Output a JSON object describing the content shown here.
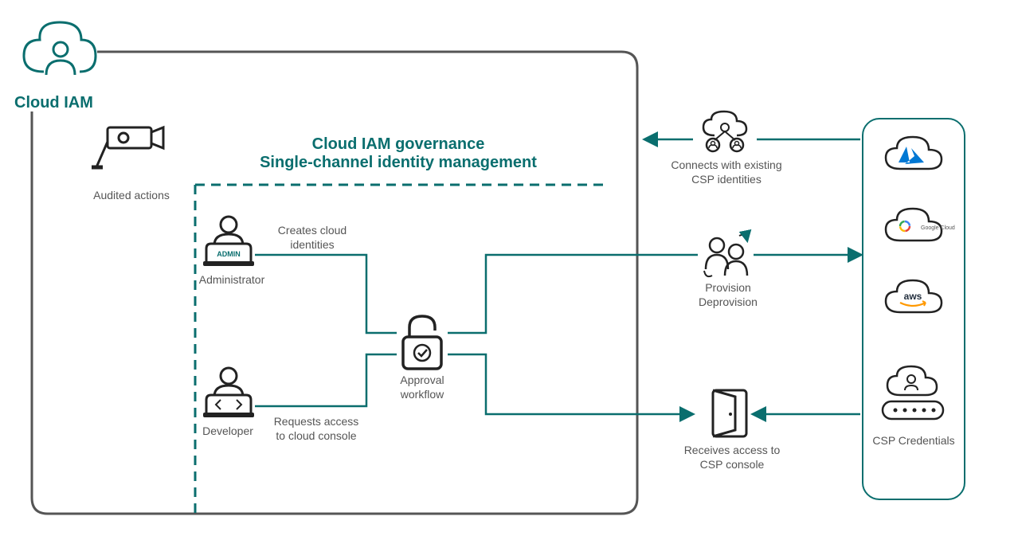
{
  "title": "Cloud IAM",
  "governance": {
    "line1": "Cloud IAM governance",
    "line2": "Single-channel identity management"
  },
  "nodes": {
    "audited": "Audited actions",
    "admin": {
      "label": "Administrator",
      "badge": "ADMIN",
      "arrow": "Creates cloud\nidentities"
    },
    "developer": {
      "label": "Developer",
      "arrow": "Requests access\nto cloud console"
    },
    "approval": "Approval\nworkflow",
    "connects": "Connects with existing\nCSP identities",
    "provision": "Provision\nDeprovision",
    "receives": "Receives access to\nCSP console",
    "csp_credentials": "CSP Credentials"
  },
  "csps": [
    "Azure",
    "Google Cloud",
    "aws"
  ],
  "colors": {
    "teal": "#0a6e6e",
    "dark": "#555",
    "line": "#0a6e6e",
    "outer": "#555"
  }
}
